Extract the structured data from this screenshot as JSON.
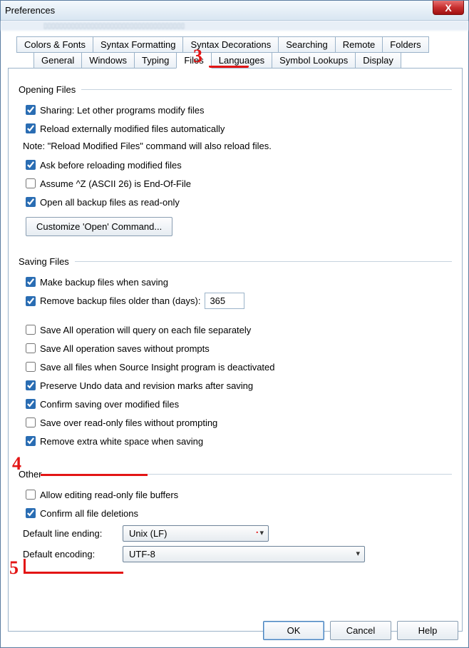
{
  "window": {
    "title": "Preferences",
    "close_label": "X"
  },
  "tabs_row1": [
    "Colors & Fonts",
    "Syntax Formatting",
    "Syntax Decorations",
    "Searching",
    "Remote",
    "Folders"
  ],
  "tabs_row2": [
    "General",
    "Windows",
    "Typing",
    "Files",
    "Languages",
    "Symbol Lookups",
    "Display"
  ],
  "active_tab": "Files",
  "sections": {
    "opening": {
      "title": "Opening Files",
      "items": {
        "sharing": {
          "checked": true,
          "label": "Sharing: Let other programs modify files"
        },
        "reload_auto": {
          "checked": true,
          "label": "Reload externally modified files automatically"
        },
        "note": "Note: \"Reload Modified Files\" command will also reload files.",
        "ask_reload": {
          "checked": true,
          "label": "Ask before reloading modified files"
        },
        "assume_eof": {
          "checked": false,
          "label": "Assume ^Z (ASCII 26) is End-Of-File"
        },
        "open_backup_ro": {
          "checked": true,
          "label": "Open all backup files as read-only"
        },
        "customize_btn": "Customize 'Open' Command..."
      }
    },
    "saving": {
      "title": "Saving Files",
      "items": {
        "make_backup": {
          "checked": true,
          "label": "Make backup files when saving"
        },
        "remove_old": {
          "checked": true,
          "label": "Remove backup files older than (days):",
          "value": "365"
        },
        "saveall_query": {
          "checked": false,
          "label": "Save All operation will query on each file separately"
        },
        "saveall_noprompt": {
          "checked": false,
          "label": "Save All operation saves without prompts"
        },
        "save_on_deact": {
          "checked": false,
          "label": "Save all files when Source Insight program is deactivated"
        },
        "preserve_undo": {
          "checked": true,
          "label": "Preserve Undo data and revision marks after saving"
        },
        "confirm_over": {
          "checked": true,
          "label": "Confirm saving over modified files"
        },
        "save_over_ro": {
          "checked": false,
          "label": "Save over read-only files without prompting"
        },
        "remove_ws": {
          "checked": true,
          "label": "Remove extra white space when saving"
        }
      }
    },
    "other": {
      "title": "Other",
      "items": {
        "allow_edit_ro": {
          "checked": false,
          "label": "Allow editing read-only file buffers"
        },
        "confirm_del": {
          "checked": true,
          "label": "Confirm all file deletions"
        },
        "line_ending": {
          "label": "Default line ending:",
          "value": "Unix (LF)"
        },
        "encoding": {
          "label": "Default encoding:",
          "value": "UTF-8"
        }
      }
    }
  },
  "buttons": {
    "ok": "OK",
    "cancel": "Cancel",
    "help": "Help"
  },
  "annotations": {
    "n3": "3",
    "n4": "4",
    "n5": "5"
  }
}
